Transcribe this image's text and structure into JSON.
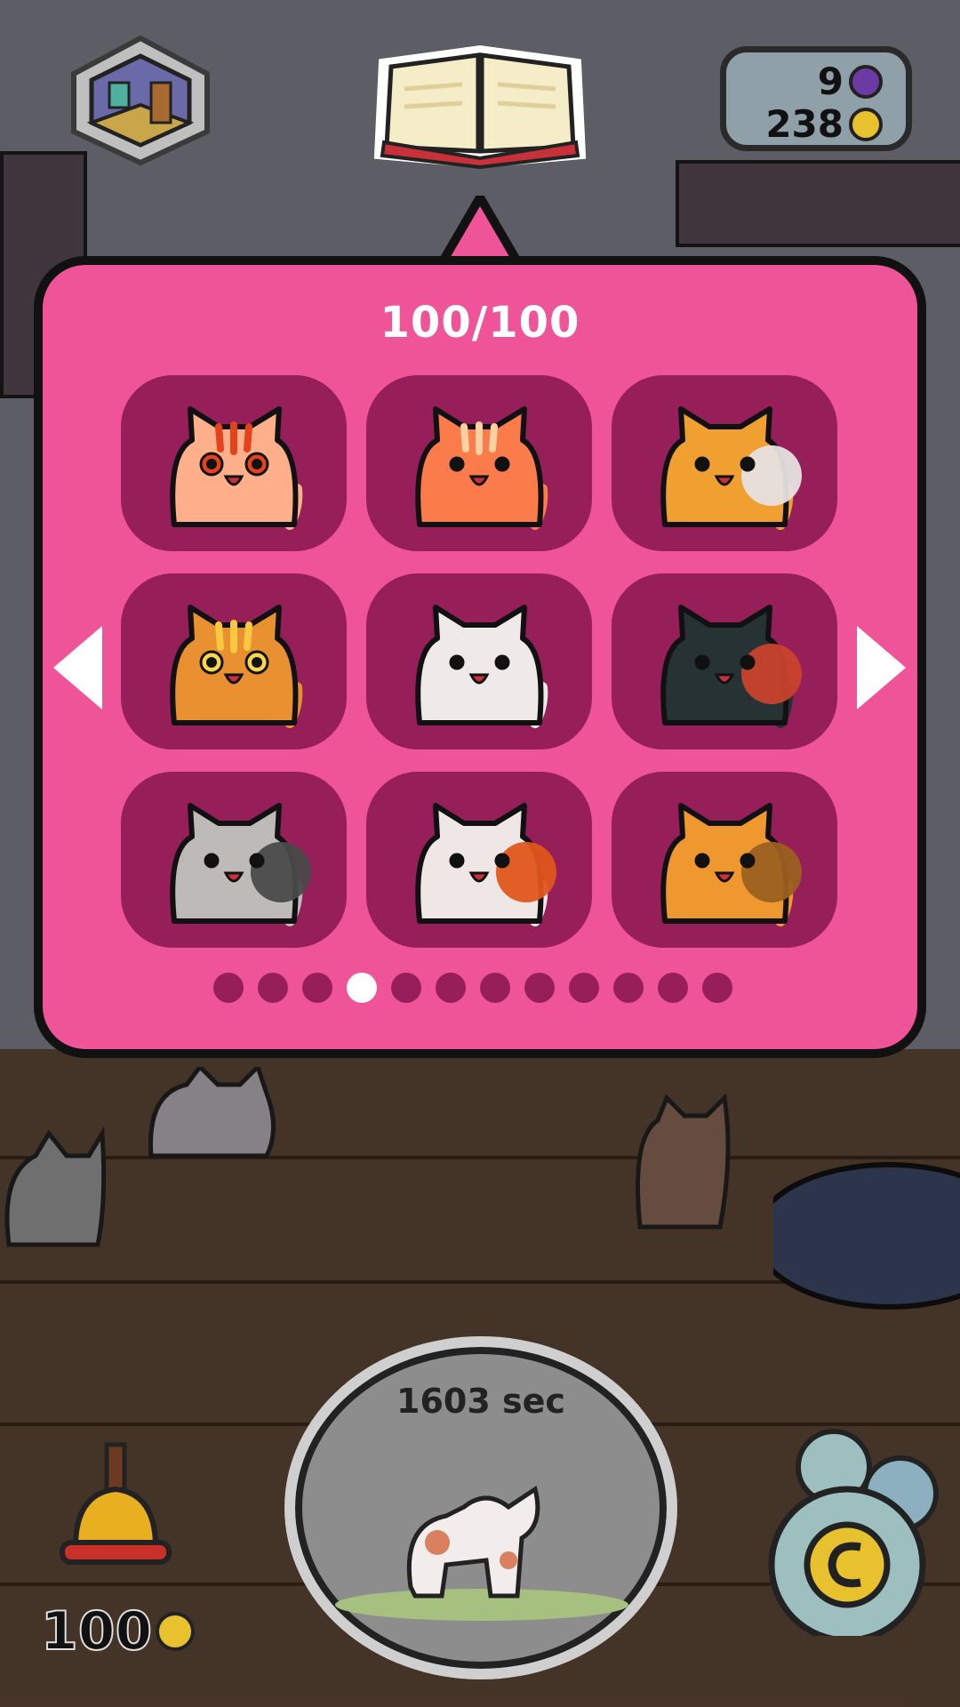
{
  "collection": {
    "counter": "100/100",
    "cats": [
      {
        "name": "peach-striped-cat",
        "body": "#ffb08a",
        "stripes": "#e4421c",
        "eye": "#e4421c"
      },
      {
        "name": "orange-tabby-cat",
        "body": "#fb7c4a",
        "stripes": "#ffd0a0",
        "eye": "#111"
      },
      {
        "name": "calico-orange-cat",
        "body": "#f0a030",
        "patch": "#e6e1e0",
        "eye": "#111"
      },
      {
        "name": "yellow-eyed-orange-cat",
        "body": "#e99030",
        "stripes": "#f8c840",
        "eye": "#f8d848"
      },
      {
        "name": "white-cat",
        "body": "#efe9ea",
        "eye": "#111"
      },
      {
        "name": "black-red-mask-cat",
        "body": "#263234",
        "patch": "#c8432c",
        "eye": "#111"
      },
      {
        "name": "gray-raccoon-cat",
        "body": "#bdbab8",
        "patch": "#4a4a4a",
        "eye": "#111"
      },
      {
        "name": "white-orange-patch-cat",
        "body": "#efe6e6",
        "patch": "#e0561c",
        "eye": "#111"
      },
      {
        "name": "spotted-orange-cat",
        "body": "#ef9830",
        "patch": "#9b6020",
        "eye": "#111"
      }
    ],
    "page_count": 12,
    "active_page": 4
  },
  "currency": {
    "gems": "9",
    "coins": "238"
  },
  "bell": {
    "price": "100"
  },
  "timer": {
    "label": "1603 sec"
  },
  "colors": {
    "popup": "#f05498",
    "tile": "#961f5a",
    "coin": "#e7c22e"
  }
}
